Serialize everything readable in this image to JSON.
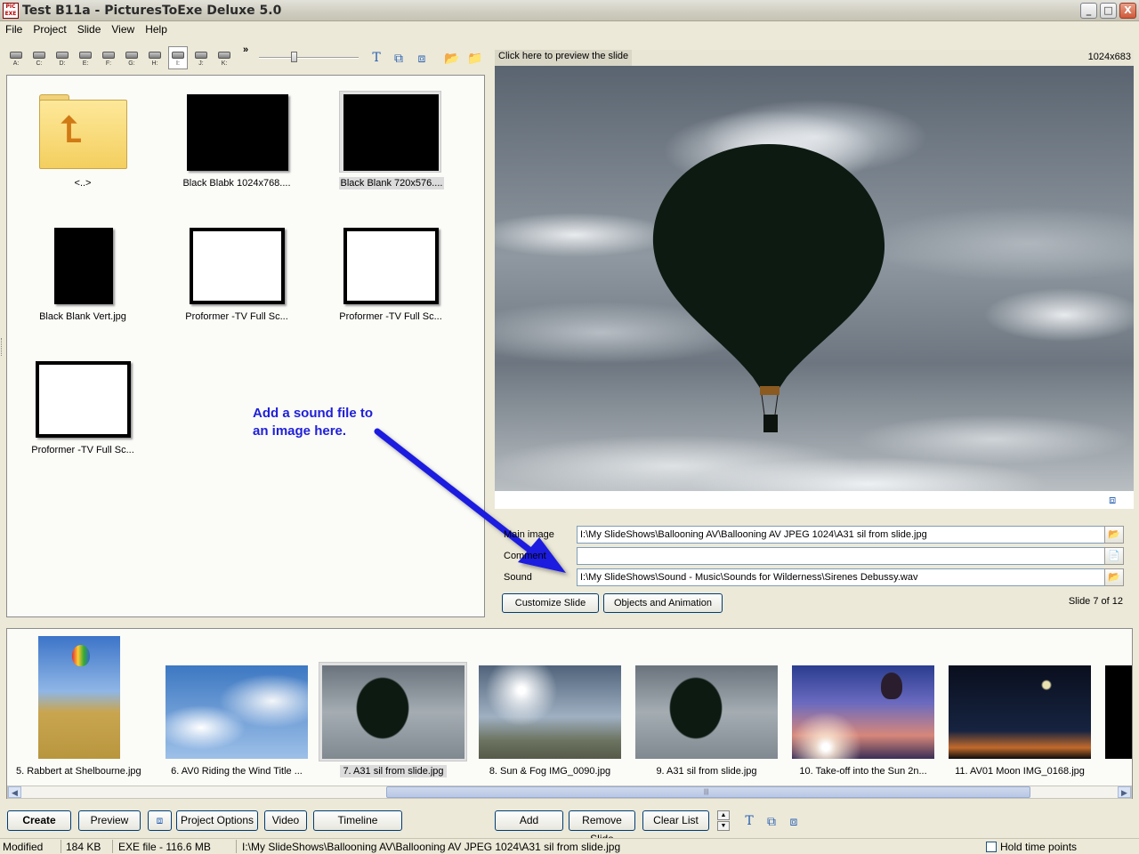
{
  "window": {
    "title": "Test B11a - PicturesToExe Deluxe 5.0",
    "app_icon_text": "PIC EXE",
    "minimize": "_",
    "maximize": "□",
    "close": "X"
  },
  "menu": [
    "File",
    "Project",
    "Slide",
    "View",
    "Help"
  ],
  "toolbar": {
    "drives": [
      "A:",
      "C:",
      "D:",
      "E:",
      "F:",
      "G:",
      "H:",
      "I:",
      "J:",
      "K:"
    ],
    "selected_drive": "I:",
    "more": "»",
    "zoom_level": 0.35
  },
  "browser": {
    "items": [
      {
        "caption": "<..>",
        "kind": "folder-up"
      },
      {
        "caption": "Black Blabk 1024x768....",
        "kind": "black"
      },
      {
        "caption": "Black Blank 720x576....",
        "kind": "black",
        "selected": true
      },
      {
        "caption": "Black Blank Vert.jpg",
        "kind": "black-vert"
      },
      {
        "caption": "Proformer -TV Full Sc...",
        "kind": "frame"
      },
      {
        "caption": "Proformer -TV Full Sc...",
        "kind": "frame"
      },
      {
        "caption": "Proformer -TV Full Sc...",
        "kind": "frame"
      }
    ]
  },
  "annotation": {
    "line1": "Add a sound file to",
    "line2": "an image here."
  },
  "preview": {
    "header": "Click here to preview the slide",
    "dimensions": "1024x683"
  },
  "fields": {
    "main_image_label": "Main image",
    "main_image_value": "I:\\My SlideShows\\Ballooning AV\\Ballooning AV JPEG 1024\\A31 sil from slide.jpg",
    "comment_label": "Comment",
    "comment_value": "",
    "sound_label": "Sound",
    "sound_value": "I:\\My SlideShows\\Sound - Music\\Sounds for Wilderness\\Sirenes Debussy.wav"
  },
  "slide_buttons": {
    "customize": "Customize Slide",
    "objects": "Objects and Animation"
  },
  "slide_count": "Slide 7 of 12",
  "slides": [
    {
      "caption": "5. Rabbert at Shelbourne.jpg"
    },
    {
      "caption": "6. AV0  Riding the Wind Title ..."
    },
    {
      "caption": "7. A31 sil from slide.jpg",
      "selected": true
    },
    {
      "caption": "8. Sun & Fog IMG_0090.jpg"
    },
    {
      "caption": "9. A31 sil from slide.jpg"
    },
    {
      "caption": "10. Take-off into the Sun 2n..."
    },
    {
      "caption": "11. AV01 Moon IMG_0168.jpg"
    }
  ],
  "bottom_buttons": {
    "create": "Create",
    "preview": "Preview",
    "project_options": "Project Options",
    "video": "Video",
    "timeline": "Timeline",
    "add": "Add",
    "remove": "Remove Slide",
    "clear": "Clear List"
  },
  "status": {
    "state": "Modified",
    "size": "184 KB",
    "exe": "EXE file - 116.6 MB",
    "path": "I:\\My SlideShows\\Ballooning AV\\Ballooning AV JPEG 1024\\A31 sil from slide.jpg",
    "hold": "Hold time points"
  },
  "colors": {
    "annotation": "#1f1fd8",
    "arrow": "#1a1ae0",
    "accent": "#2860b4"
  }
}
